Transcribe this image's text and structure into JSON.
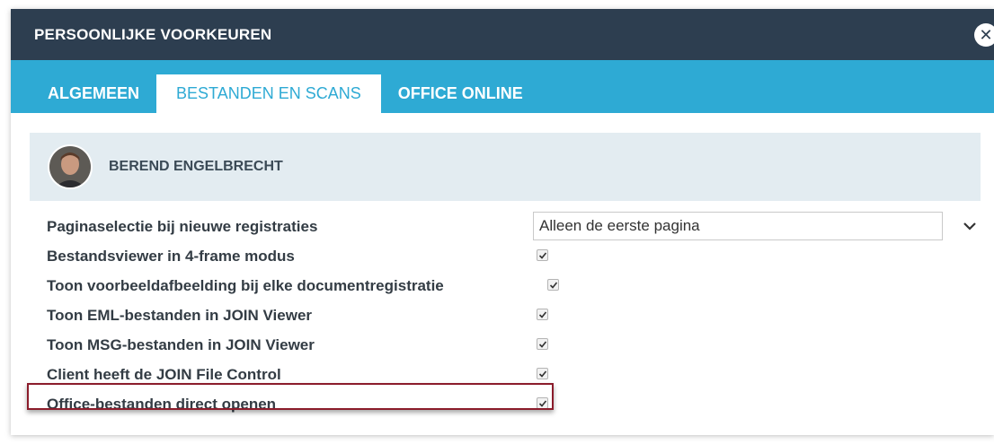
{
  "dialog": {
    "title": "PERSOONLIJKE VOORKEUREN",
    "close_icon": "close-icon"
  },
  "tabs": [
    {
      "label": "ALGEMEEN",
      "active": false
    },
    {
      "label": "BESTANDEN EN SCANS",
      "active": true
    },
    {
      "label": "OFFICE ONLINE",
      "active": false
    }
  ],
  "user": {
    "name": "BEREND ENGELBRECHT",
    "avatar_icon": "user-avatar"
  },
  "settings": {
    "page_selection": {
      "label": "Paginaselectie bij nieuwe registraties",
      "value": "Alleen de eerste pagina"
    },
    "items": [
      {
        "label": "Bestandsviewer in 4-frame modus",
        "checked": true
      },
      {
        "label": "Toon voorbeeldafbeelding bij elke documentregistratie",
        "checked": true
      },
      {
        "label": "Toon EML-bestanden in JOIN Viewer",
        "checked": true
      },
      {
        "label": "Toon MSG-bestanden in JOIN Viewer",
        "checked": true
      },
      {
        "label": "Client heeft de JOIN File Control",
        "checked": true
      },
      {
        "label": "Office-bestanden direct openen",
        "checked": true,
        "highlighted": true
      }
    ]
  },
  "colors": {
    "titlebar": "#2d3e50",
    "tabbar": "#2eaad4",
    "userbar": "#e3ecf1",
    "highlight": "#8b1c2b"
  }
}
